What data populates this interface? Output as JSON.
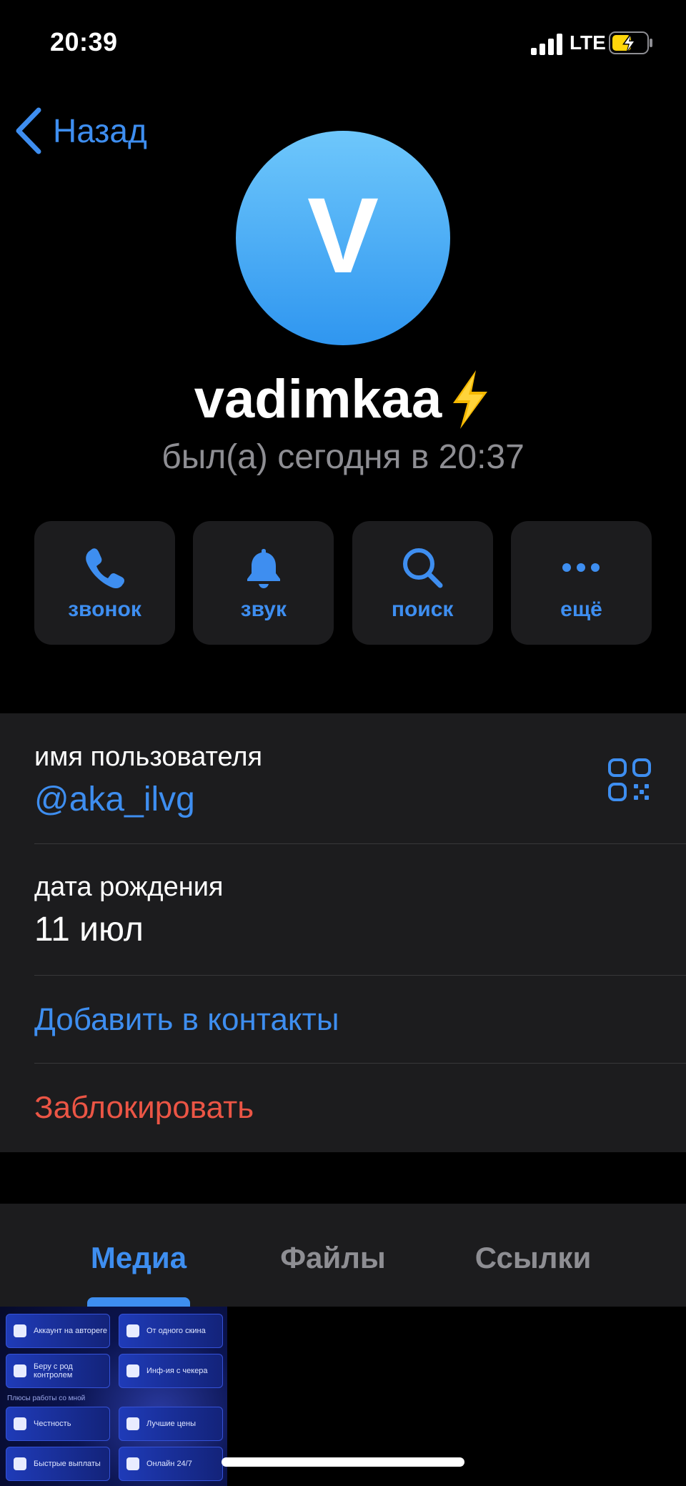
{
  "status_bar": {
    "time": "20:39",
    "network": "LTE"
  },
  "nav": {
    "back_label": "Назад"
  },
  "profile": {
    "avatar_letter": "V",
    "name": "vadimkaa",
    "last_seen": "был(а) сегодня в 20:37"
  },
  "actions": [
    {
      "label": "звонок",
      "icon": "phone-icon"
    },
    {
      "label": "звук",
      "icon": "bell-icon"
    },
    {
      "label": "поиск",
      "icon": "search-icon"
    },
    {
      "label": "ещё",
      "icon": "more-icon"
    }
  ],
  "info": {
    "username_label": "имя пользователя",
    "username_value": "@aka_ilvg",
    "birthday_label": "дата рождения",
    "birthday_value": "11 июл",
    "add_contact": "Добавить в контакты",
    "block": "Заблокировать"
  },
  "tabs": [
    {
      "label": "Медиа",
      "active": true
    },
    {
      "label": "Файлы",
      "active": false
    },
    {
      "label": "Ссылки",
      "active": false
    }
  ],
  "media_thumbnail": {
    "tiles": [
      "Аккаунт на автореге",
      "От одного скина",
      "Беру с род контролем",
      "Инф-ия с чекера",
      "Честность",
      "Лучшие цены",
      "Быстрые выплаты",
      "Онлайн 24/7"
    ],
    "caption": "Плюсы работы со мной"
  },
  "colors": {
    "accent": "#3e8ef0",
    "destructive": "#eb5545",
    "card": "#1c1c1e",
    "secondary_text": "#8e8e93"
  }
}
